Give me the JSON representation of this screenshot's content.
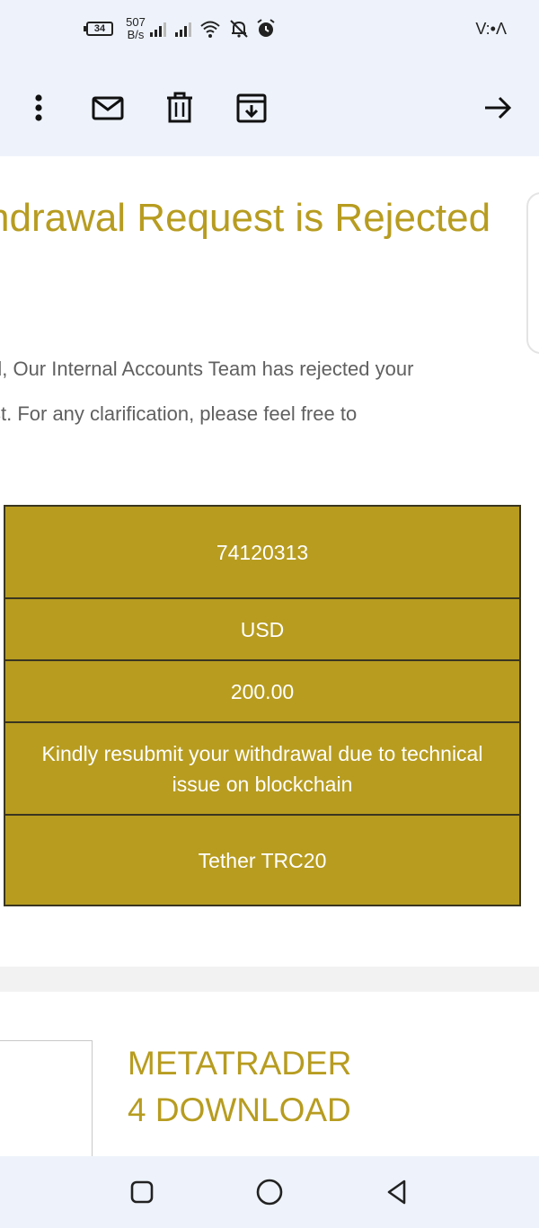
{
  "status_bar": {
    "battery": "34",
    "net_speed": "507 B/s",
    "clock": "V:•Λ"
  },
  "toolbar": {
    "icons": [
      "more-vert-icon",
      "mail-icon",
      "trash-icon",
      "archive-icon",
      "forward-arrow-icon"
    ]
  },
  "email": {
    "headline": "ndrawal Request is Rejected\nt",
    "body": "d, Our Internal Accounts Team has rejected your\nst. For any clarification, please feel free to",
    "details": [
      {
        "value": "74120313"
      },
      {
        "value": "USD"
      },
      {
        "value": "200.00"
      },
      {
        "value": "Kindly resubmit your withdrawal due to technical issue on blockchain"
      },
      {
        "value": "Tether TRC20"
      }
    ],
    "banner_title": "METATRADER\n4 DOWNLOAD"
  },
  "colors": {
    "brand_gold": "#b79c20",
    "table_border": "#3a3520",
    "chrome_bg": "#eef3fb"
  }
}
